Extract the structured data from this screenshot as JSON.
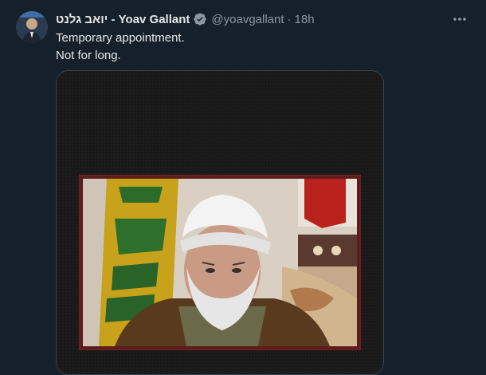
{
  "tweet": {
    "display_name": "יואב גלנט - Yoav Gallant",
    "handle": "@yoavgallant",
    "separator": "·",
    "time": "18h",
    "text_line1": "Temporary appointment.",
    "text_line2": "Not for long."
  },
  "icons": {
    "verified": "verified-badge-icon",
    "more": "more-options-icon"
  },
  "colors": {
    "background": "#15202b",
    "text": "#e7e9ea",
    "secondary_text": "#8b98a5",
    "verified_badge": "#8b98a5",
    "border": "#38444d"
  }
}
